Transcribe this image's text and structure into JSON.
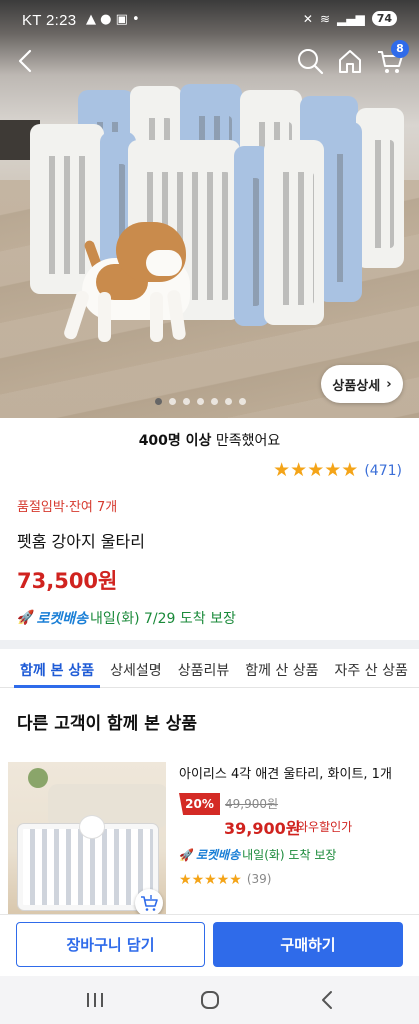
{
  "status_bar": {
    "carrier": "KT",
    "time": "2:23",
    "battery": "74"
  },
  "header": {
    "cart_count": "8"
  },
  "gallery": {
    "detail_button": "상품상세",
    "total_images": 7,
    "active_index": 0
  },
  "product": {
    "satisfaction_bold": "400명 이상",
    "satisfaction_text": " 만족했어요",
    "rating": 5,
    "review_count": "(471)",
    "stock_notice": "품절임박·잔여 7개",
    "title": "펫홈 강아지 울타리",
    "price": "73,500원",
    "delivery_badge": "로켓배송",
    "delivery_text": " 내일(화) 7/29 도착 보장"
  },
  "tabs": [
    {
      "label": "함께 본 상품",
      "active": true
    },
    {
      "label": "상세설명",
      "active": false
    },
    {
      "label": "상품리뷰",
      "active": false
    },
    {
      "label": "함께 산 상품",
      "active": false
    },
    {
      "label": "자주 산 상품",
      "active": false
    }
  ],
  "recommend": {
    "section_title": "다른 고객이 함께 본 상품",
    "item": {
      "title": "아이리스 4각 애견 울타리, 화이트, 1개",
      "discount": "20%",
      "original_price": "49,900원",
      "price": "39,900원",
      "price_note": "와우할인가",
      "delivery_badge": "로켓배송",
      "delivery_text": " 내일(화) 도착 보장",
      "rating": 5,
      "review_count": "(39)"
    }
  },
  "actions": {
    "add_to_cart": "장바구니 담기",
    "buy_now": "구매하기"
  },
  "colors": {
    "accent": "#2f6bea",
    "price": "#d0231f",
    "star": "#f4a418",
    "delivery_green": "#1a8a3a"
  }
}
